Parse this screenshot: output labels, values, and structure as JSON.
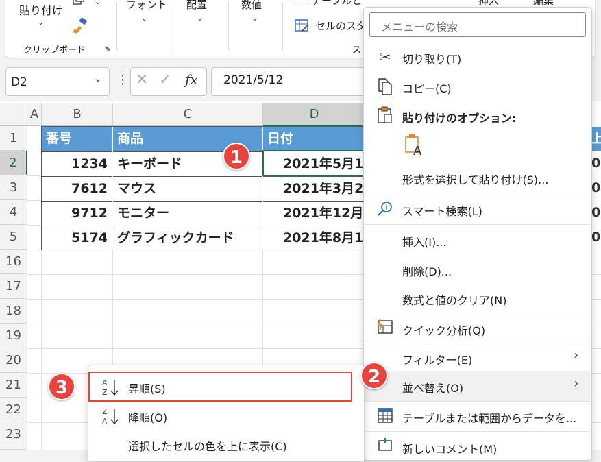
{
  "ribbon": {
    "paste": {
      "label": "貼り付け"
    },
    "clipboard_group": "クリップボード",
    "groups": {
      "font": "フォント",
      "alignment": "配置",
      "number": "数値"
    },
    "table_format_label": "テーブルとして書式設定",
    "cell_styles_label": "セルのスタ",
    "styles_group_partial": "ス",
    "insert_partial": "挿入",
    "edit_partial": "編集"
  },
  "formula_bar": {
    "name_box": "D2",
    "cancel_icon": "✕",
    "enter_icon": "✓",
    "fx_label": "fx",
    "value": "2021/5/12"
  },
  "sheet": {
    "columns": [
      "A",
      "B",
      "C",
      "D"
    ],
    "rows": [
      "1",
      "2",
      "3",
      "4",
      "5",
      "16",
      "17",
      "18",
      "19",
      "20",
      "21",
      "22",
      "23"
    ],
    "header": {
      "b": "番号",
      "c": "商品",
      "d": "日付",
      "e_partial": "上"
    },
    "data": [
      {
        "b": "1234",
        "c": "キーボード",
        "d": "2021年5月1",
        "e_partial": "0"
      },
      {
        "b": "7612",
        "c": "マウス",
        "d": "2021年3月2",
        "e_partial": "0"
      },
      {
        "b": "9712",
        "c": "モニター",
        "d": "2021年12月",
        "e_partial": "0"
      },
      {
        "b": "5174",
        "c": "グラフィックカード",
        "d": "2021年8月1",
        "e_partial": "0"
      }
    ]
  },
  "context_menu": {
    "search_placeholder": "メニューの検索",
    "cut": "切り取り(T)",
    "copy": "コピー(C)",
    "paste_options": "貼り付けのオプション:",
    "paste_special": "形式を選択して貼り付け(S)...",
    "smart_lookup": "スマート検索(L)",
    "insert": "挿入(I)...",
    "delete": "削除(D)...",
    "clear_contents": "数式と値のクリア(N)",
    "quick_analysis": "クイック分析(Q)",
    "filter": "フィルター(E)",
    "sort": "並べ替え(O)",
    "table_from_range": "テーブルまたは範囲からデータを...",
    "new_comment": "新しいコメント(M)"
  },
  "sort_submenu": {
    "ascending": "昇順(S)",
    "descending": "降順(O)",
    "cell_color_top": "選択したセルの色を上に表示(C)"
  },
  "badges": [
    "1",
    "2",
    "3"
  ],
  "colors": {
    "header_fill": "#5b9bd5",
    "badge": "#e8433d",
    "highlight_border": "#e8433d",
    "selection": "#217346"
  }
}
